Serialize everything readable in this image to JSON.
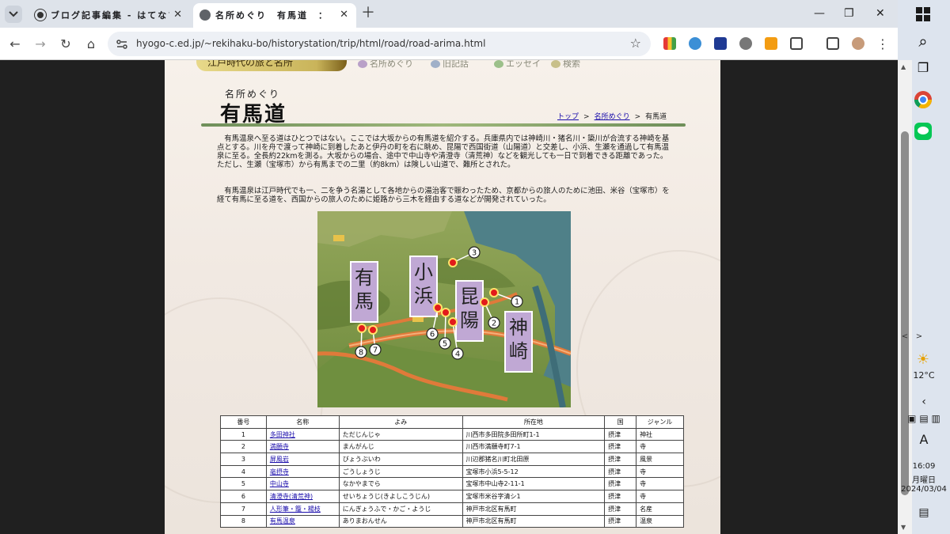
{
  "browser": {
    "tabs": [
      {
        "title": "ブログ記事編集 - はてなブログ",
        "active": false
      },
      {
        "title": "名所めぐり　有馬道　：　ひょうご歴史",
        "active": true
      }
    ],
    "url": "hyogo-c.ed.jp/~rekihaku-bo/historystation/trip/html/road/road-arima.html"
  },
  "page": {
    "banner": "江戸時代の旅と名所",
    "topnav": [
      "名所めぐり",
      "旧記話",
      "エッセイ",
      "検索"
    ],
    "subtitle": "名所めぐり",
    "title": "有馬道",
    "breadcrumb": {
      "top": "トップ",
      "meisho": "名所めぐり",
      "current": "有馬道",
      "sep": ">"
    },
    "para1": "有馬温泉へ至る道はひとつではない。ここでは大坂からの有馬道を紹介する。兵庫県内では神崎川・猪名川・簗川が合流する神崎を基点とする。川を舟で渡って神崎に到着したあと伊丹の町を右に眺め、昆陽で西国街道（山陽道）と交差し、小浜、生瀬を通過して有馬温泉に至る。全長約22kmを測る。大坂からの場合、途中で中山寺や清澄寺（清荒神）などを観光しても一日で到着できる距離であった。ただし、生瀬（宝塚市）から有馬までの二里（約8km）は険しい山道で、難所とされた。",
    "para2": "有馬温泉は江戸時代でも一、二を争う名湯として各地からの湯治客で賑わったため、京都からの旅人のために池田、米谷（宝塚市）を経て有馬に至る道を、西国からの旅人のために姫路から三木を経由する道などが開発されていった。",
    "map": {
      "labels": [
        "有馬",
        "小浜",
        "昆陽",
        "神崎"
      ],
      "markers": [
        "1",
        "2",
        "3",
        "4",
        "5",
        "6",
        "7",
        "8"
      ]
    },
    "table": {
      "headers": [
        "番号",
        "名称",
        "よみ",
        "所在地",
        "国",
        "ジャンル"
      ],
      "rows": [
        [
          "1",
          "多田神社",
          "ただじんじゃ",
          "川西市多田院多田所町1-1",
          "摂津",
          "神社"
        ],
        [
          "2",
          "満願寺",
          "まんがんじ",
          "川西市満願寺町7-1",
          "摂津",
          "寺"
        ],
        [
          "3",
          "屏風岩",
          "びょうぶいわ",
          "川辺郡猪名川町北田原",
          "摂津",
          "風景"
        ],
        [
          "4",
          "亳摂寺",
          "ごうしょうじ",
          "宝塚市小浜5-5-12",
          "摂津",
          "寺"
        ],
        [
          "5",
          "中山寺",
          "なかやまでら",
          "宝塚市中山寺2-11-1",
          "摂津",
          "寺"
        ],
        [
          "6",
          "清澄寺(清荒神)",
          "せいちょうじ(きよしこうじん)",
          "宝塚市米谷字清シ1",
          "摂津",
          "寺"
        ],
        [
          "7",
          "人形筆・籠・楊枝",
          "にんぎょうふで・かご・ようじ",
          "神戸市北区有馬町",
          "摂津",
          "名産"
        ],
        [
          "8",
          "有馬温泉",
          "ありまおんせん",
          "神戸市北区有馬町",
          "摂津",
          "温泉"
        ]
      ]
    }
  },
  "taskbar": {
    "weather": "12°C",
    "input_mode": "A",
    "time": "16:09",
    "weekday": "月曜日",
    "date": "2024/03/04"
  }
}
